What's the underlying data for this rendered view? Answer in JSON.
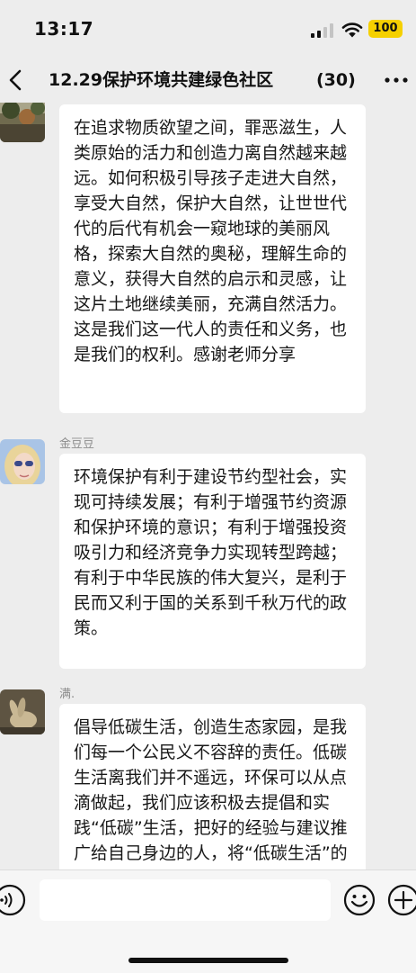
{
  "status_bar": {
    "time": "13:17",
    "battery": "100",
    "battery_color": "#f5d000"
  },
  "header": {
    "title": "12.29保护环境共建绿色社区",
    "member_count": "(30)",
    "back_icon": "chevron-left-icon",
    "more_icon": "more-dots-icon"
  },
  "messages": [
    {
      "sender": "",
      "avatar": "nature-photo-avatar",
      "text": "在追求物质欲望之间，罪恶滋生，人类原始的活力和创造力离自然越来越远。如何积极引导孩子走进大自然，享受大自然，保护大自然，让世世代代的后代有机会一窥地球的美丽风格，探索大自然的奥秘，理解生命的意义，获得大自然的启示和灵感，让这片土地继续美丽，充满自然活力。这是我们这一代人的责任和义务，也是我们的权利。感谢老师分享"
    },
    {
      "sender": "金豆豆",
      "avatar": "girl-sunglasses-avatar",
      "text": "环境保护有利于建设节约型社会，实现可持续发展；有利于增强节约资源和保护环境的意识；有利于增强投资吸引力和经济竞争力实现转型跨越；有利于中华民族的伟大复兴，是利于民而又利于国的关系到千秋万代的政策。"
    },
    {
      "sender": "满.",
      "avatar": "rabbit-figure-avatar",
      "text": "倡导低碳生活，创造生态家园，是我们每一个公民义不容辞的责任。低碳生活离我们并不遥远，环保可以从点滴做起，我们应该积极去提倡和实践“低碳”生活，把好的经验与建议推广给自己身边的人，将“低碳生活”的绿色概"
    }
  ],
  "input_bar": {
    "voice_icon": "voice-icon",
    "emoji_icon": "emoji-icon",
    "plus_icon": "plus-icon",
    "input_value": ""
  },
  "colors": {
    "chat_background": "#ededed",
    "bubble_background": "#ffffff",
    "sender_name": "#8c8c8c"
  }
}
